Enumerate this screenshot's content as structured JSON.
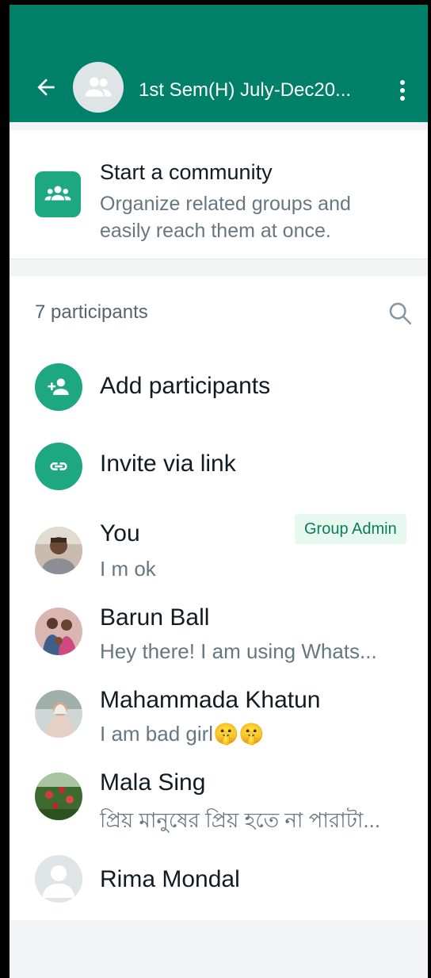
{
  "header": {
    "title": "1st Sem(H) July-Dec20...",
    "back_icon": "arrow-left-icon",
    "avatar_icon": "group-icon",
    "menu_icon": "more-vertical-icon",
    "bg_color": "#008069"
  },
  "community": {
    "title": "Start a community",
    "description": "Organize related groups and easily reach them at once.",
    "icon": "community-icon"
  },
  "participants": {
    "count_label": "7 participants",
    "search_icon": "search-icon",
    "actions": [
      {
        "label": "Add participants",
        "icon": "add-person-icon"
      },
      {
        "label": "Invite via link",
        "icon": "link-icon"
      }
    ],
    "members": [
      {
        "name": "You",
        "status": "I m ok",
        "badge": "Group Admin"
      },
      {
        "name": "Barun Ball",
        "status": "Hey there! I am using Whats..."
      },
      {
        "name": "Mahammada Khatun",
        "status": "I am bad girl🤫🤫"
      },
      {
        "name": "Mala Sing",
        "status": "প্রিয় মানুষের প্রিয় হতে না পারাটা..."
      },
      {
        "name": "Rima  Mondal",
        "status": ""
      }
    ]
  },
  "colors": {
    "accent": "#1ea881",
    "badge_bg": "#e7f8ef",
    "badge_text": "#0a7c57"
  }
}
